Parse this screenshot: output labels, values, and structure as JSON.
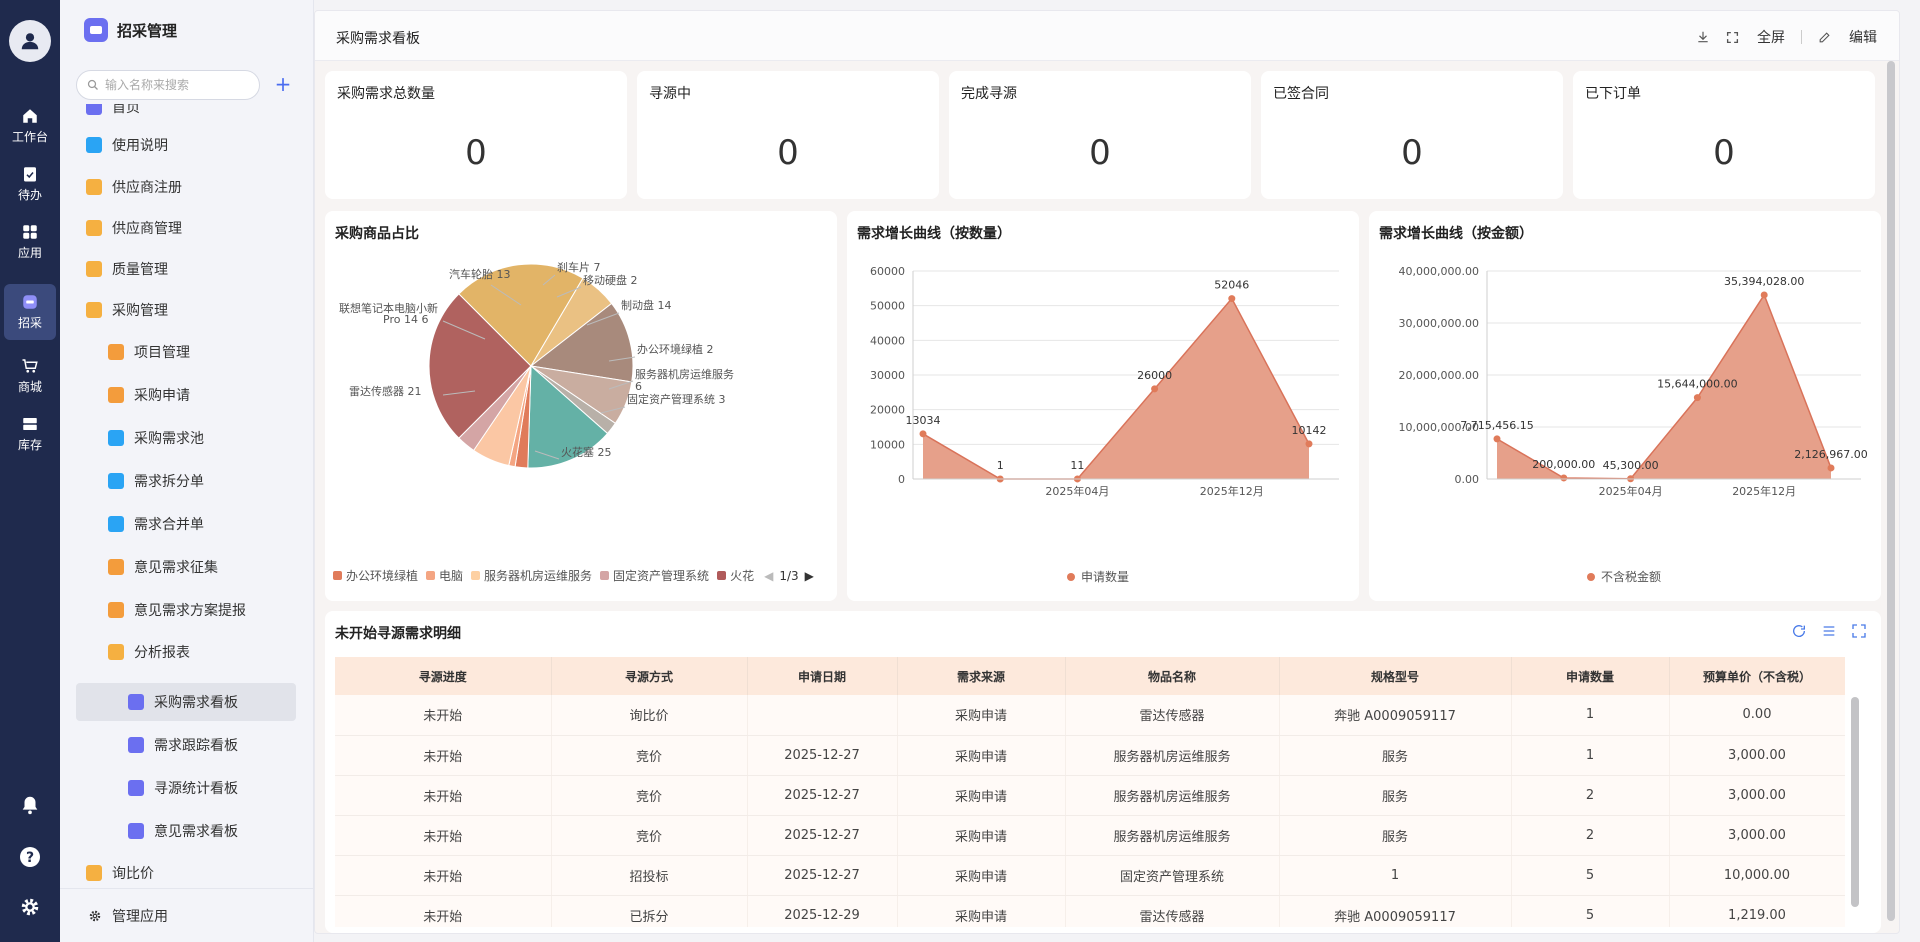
{
  "rail": {
    "items": [
      {
        "label": "工作台",
        "icon": "home-icon"
      },
      {
        "label": "待办",
        "icon": "clipboard-check-icon"
      },
      {
        "label": "应用",
        "icon": "apps-grid-icon"
      },
      {
        "label": "招采",
        "icon": "procurement-icon"
      },
      {
        "label": "商城",
        "icon": "cart-icon"
      },
      {
        "label": "库存",
        "icon": "inventory-icon"
      }
    ]
  },
  "sidebar": {
    "app_title": "招采管理",
    "search_placeholder": "输入名称来搜索",
    "add_label": "+",
    "items": [
      {
        "label": "首页",
        "icon": "home-page-icon",
        "color": "#6b6ff0"
      },
      {
        "label": "使用说明",
        "icon": "document-icon",
        "color": "#2aa4f4"
      },
      {
        "label": "供应商注册",
        "icon": "folder-icon",
        "color": "#f5b041"
      },
      {
        "label": "供应商管理",
        "icon": "folder-icon",
        "color": "#f5b041"
      },
      {
        "label": "质量管理",
        "icon": "folder-icon",
        "color": "#f5b041"
      },
      {
        "label": "采购管理",
        "icon": "folder-open-icon",
        "color": "#f5b041"
      },
      {
        "label": "项目管理",
        "icon": "form-icon",
        "color": "#f39c3c"
      },
      {
        "label": "采购申请",
        "icon": "form-icon",
        "color": "#f39c3c"
      },
      {
        "label": "采购需求池",
        "icon": "document-icon",
        "color": "#2aa4f4"
      },
      {
        "label": "需求拆分单",
        "icon": "document-icon",
        "color": "#2aa4f4"
      },
      {
        "label": "需求合并单",
        "icon": "document-icon",
        "color": "#2aa4f4"
      },
      {
        "label": "意见需求征集",
        "icon": "form-icon",
        "color": "#f39c3c"
      },
      {
        "label": "意见需求方案提报",
        "icon": "form-icon",
        "color": "#f39c3c"
      },
      {
        "label": "分析报表",
        "icon": "folder-open-icon",
        "color": "#f5b041"
      },
      {
        "label": "采购需求看板",
        "icon": "chart-icon",
        "color": "#6b6ff0"
      },
      {
        "label": "需求跟踪看板",
        "icon": "chart-icon",
        "color": "#6b6ff0"
      },
      {
        "label": "寻源统计看板",
        "icon": "chart-icon",
        "color": "#6b6ff0"
      },
      {
        "label": "意见需求看板",
        "icon": "chart-icon",
        "color": "#6b6ff0"
      },
      {
        "label": "询比价",
        "icon": "folder-icon",
        "color": "#f5b041"
      }
    ],
    "manage_label": "管理应用"
  },
  "topbar": {
    "title": "采购需求看板",
    "fullscreen_label": "全屏",
    "edit_label": "编辑"
  },
  "kpis": [
    {
      "label": "采购需求总数量",
      "value": "0"
    },
    {
      "label": "寻源中",
      "value": "0"
    },
    {
      "label": "完成寻源",
      "value": "0"
    },
    {
      "label": "已签合同",
      "value": "0"
    },
    {
      "label": "已下订单",
      "value": "0"
    }
  ],
  "pie_card": {
    "title": "采购商品占比",
    "legend": [
      {
        "name": "办公环境绿植",
        "color": "#e07b5a"
      },
      {
        "name": "电脑",
        "color": "#f4a582"
      },
      {
        "name": "服务器机房运维服务",
        "color": "#fdd0a2"
      },
      {
        "name": "固定资产管理系统",
        "color": "#d4a5a5"
      },
      {
        "name": "火花",
        "color": "#b05a5a"
      }
    ],
    "pager": "1/3"
  },
  "line1_card": {
    "title": "需求增长曲线（按数量）",
    "legend": "申请数量"
  },
  "line2_card": {
    "title": "需求增长曲线（按金额）",
    "legend": "不含税金额"
  },
  "chart_data": [
    {
      "type": "pie",
      "title": "采购商品占比",
      "slices": [
        {
          "name": "火花塞",
          "value": 25,
          "color": "#b0625f"
        },
        {
          "name": "雷达传感器",
          "value": 21,
          "color": "#e2b467"
        },
        {
          "name": "联想笔记本电脑小新Pro 14",
          "value": 6,
          "color": "#eac183"
        },
        {
          "name": "汽车轮胎",
          "value": 13,
          "color": "#a88a7c"
        },
        {
          "name": "刹车片",
          "value": 7,
          "color": "#c9ada0"
        },
        {
          "name": "移动硬盘",
          "value": 2,
          "color": "#b8b0a8"
        },
        {
          "name": "制动盘",
          "value": 14,
          "color": "#64b1a6"
        },
        {
          "name": "办公环境绿植",
          "value": 2,
          "color": "#e07b5a"
        },
        {
          "name": "电脑",
          "value": 1,
          "color": "#f4a582"
        },
        {
          "name": "服务器机房运维服务",
          "value": 6,
          "color": "#fbc7a4"
        },
        {
          "name": "固定资产管理系统",
          "value": 3,
          "color": "#d4a5a5"
        }
      ],
      "labels": [
        "汽车轮胎 13",
        "刹车片 7",
        "移动硬盘 2",
        "制动盘 14",
        "办公环境绿植 2",
        "服务器机房运维服务",
        "6",
        "固定资产管理系统 3",
        "火花塞 25",
        "雷达传感器 21",
        "联想笔记本电脑小新",
        "Pro 14 6"
      ]
    },
    {
      "type": "area",
      "title": "需求增长曲线（按数量）",
      "series": [
        {
          "name": "申请数量",
          "values": [
            13034,
            1,
            11,
            26000,
            52046,
            10142
          ]
        }
      ],
      "x_ticks": [
        "2025年04月",
        "2025年12月"
      ],
      "y_ticks": [
        "60000",
        "50000",
        "40000",
        "30000",
        "20000",
        "10000",
        "0"
      ],
      "point_labels": [
        "13034",
        "1",
        "11",
        "26000",
        "52046",
        "10142"
      ],
      "ylim": [
        0,
        60000
      ]
    },
    {
      "type": "area",
      "title": "需求增长曲线（按金额）",
      "series": [
        {
          "name": "不含税金额",
          "values": [
            7715456.15,
            200000,
            45300,
            15644000,
            35394028,
            2126967
          ]
        }
      ],
      "x_ticks": [
        "2025年04月",
        "2025年12月"
      ],
      "y_ticks": [
        "40,000,000.00",
        "30,000,000.00",
        "20,000,000.00",
        "10,000,000.00",
        "0.00"
      ],
      "point_labels": [
        "7,715,456.15",
        "200,000.00",
        "45,300.00",
        "15,644,000.00",
        "35,394,028.00",
        "2,126,967.00"
      ],
      "ylim": [
        0,
        40000000
      ]
    }
  ],
  "table": {
    "title": "未开始寻源需求明细",
    "columns": [
      "寻源进度",
      "寻源方式",
      "申请日期",
      "需求来源",
      "物品名称",
      "规格型号",
      "申请数量",
      "预算单价（不含税）"
    ],
    "rows": [
      [
        "未开始",
        "询比价",
        "",
        "采购申请",
        "雷达传感器",
        "奔驰 A0009059117",
        "1",
        "0.00"
      ],
      [
        "未开始",
        "竞价",
        "2025-12-27",
        "采购申请",
        "服务器机房运维服务",
        "服务",
        "1",
        "3,000.00"
      ],
      [
        "未开始",
        "竞价",
        "2025-12-27",
        "采购申请",
        "服务器机房运维服务",
        "服务",
        "2",
        "3,000.00"
      ],
      [
        "未开始",
        "竞价",
        "2025-12-27",
        "采购申请",
        "服务器机房运维服务",
        "服务",
        "2",
        "3,000.00"
      ],
      [
        "未开始",
        "招投标",
        "2025-12-27",
        "采购申请",
        "固定资产管理系统",
        "1",
        "5",
        "10,000.00"
      ],
      [
        "未开始",
        "已拆分",
        "2025-12-29",
        "采购申请",
        "雷达传感器",
        "奔驰 A0009059117",
        "5",
        "1,219.00"
      ]
    ]
  }
}
